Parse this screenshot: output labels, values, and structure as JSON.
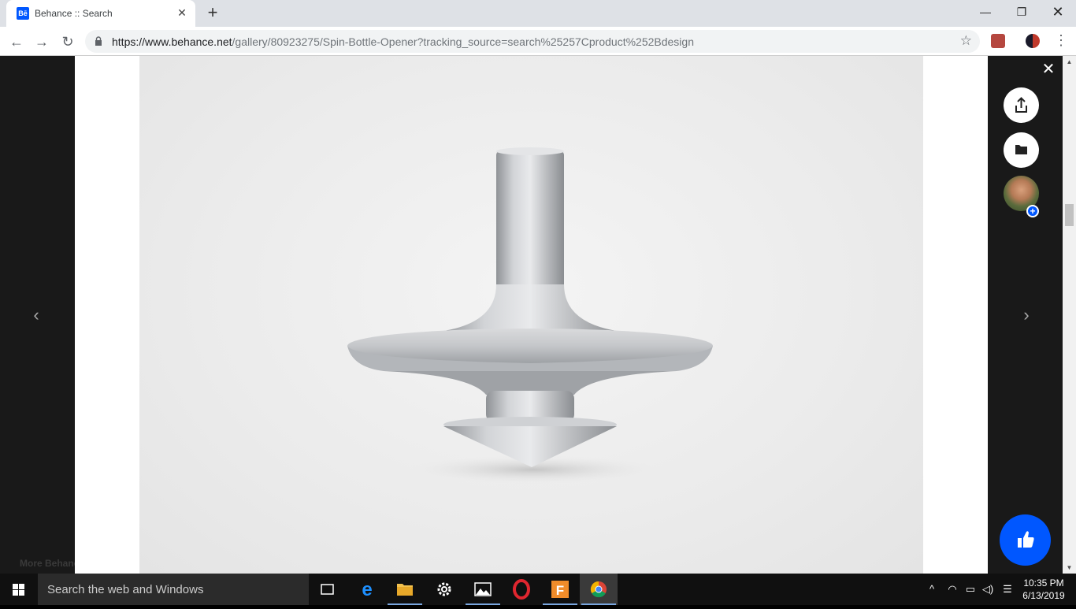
{
  "browser": {
    "tab_title": "Behance :: Search",
    "tab_favicon_text": "Bē",
    "url_host": "https://www.behance.net",
    "url_path": "/gallery/80923275/Spin-Bottle-Opener?tracking_source=search%25257Cproduct%252Bdesign"
  },
  "page": {
    "more_behance": "More Behance"
  },
  "taskbar": {
    "search_placeholder": "Search the web and Windows",
    "time": "10:35 PM",
    "date": "6/13/2019"
  },
  "colors": {
    "behance_blue": "#0057ff",
    "page_bg": "#191919",
    "taskbar_bg": "#101010"
  }
}
